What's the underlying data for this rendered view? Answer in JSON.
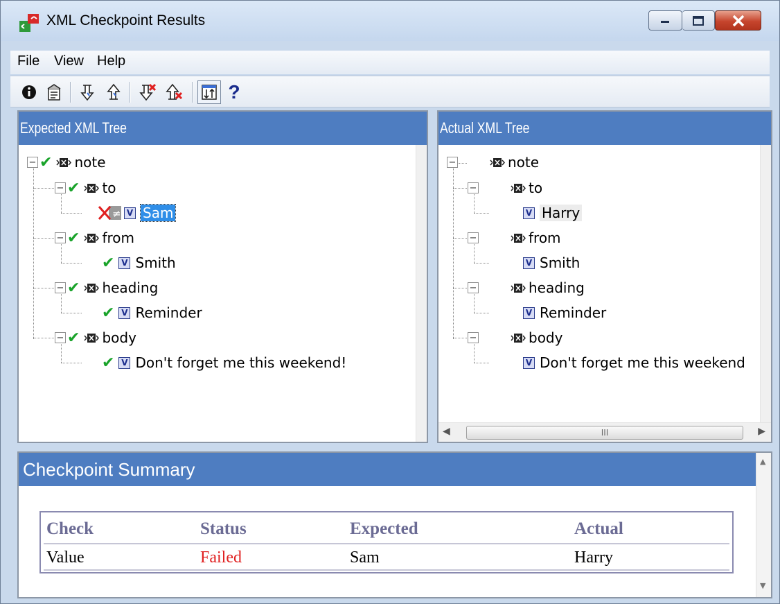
{
  "window": {
    "title": "XML Checkpoint Results"
  },
  "menu": {
    "items": [
      "File",
      "View",
      "Help"
    ]
  },
  "toolbar": {
    "buttons": [
      "info-icon",
      "properties-icon",
      "next-down-icon",
      "previous-up-icon",
      "next-error-icon",
      "previous-error-icon",
      "sync-scroll-icon",
      "help-icon"
    ],
    "help_glyph": "?"
  },
  "expected_tree": {
    "header": "Expected XML Tree",
    "nodes": [
      {
        "label": "note",
        "type": "element",
        "status": "pass"
      },
      {
        "label": "to",
        "type": "element",
        "status": "pass"
      },
      {
        "label": "Sam",
        "type": "value",
        "status": "fail",
        "selected": true
      },
      {
        "label": "from",
        "type": "element",
        "status": "pass"
      },
      {
        "label": "Smith",
        "type": "value",
        "status": "pass"
      },
      {
        "label": "heading",
        "type": "element",
        "status": "pass"
      },
      {
        "label": "Reminder",
        "type": "value",
        "status": "pass"
      },
      {
        "label": "body",
        "type": "element",
        "status": "pass"
      },
      {
        "label": "Don't forget me this weekend!",
        "type": "value",
        "status": "pass"
      }
    ]
  },
  "actual_tree": {
    "header": "Actual XML Tree",
    "nodes": [
      {
        "label": "note",
        "type": "element"
      },
      {
        "label": "to",
        "type": "element"
      },
      {
        "label": "Harry",
        "type": "value",
        "highlighted": true
      },
      {
        "label": "from",
        "type": "element"
      },
      {
        "label": "Smith",
        "type": "value"
      },
      {
        "label": "heading",
        "type": "element"
      },
      {
        "label": "Reminder",
        "type": "value"
      },
      {
        "label": "body",
        "type": "element"
      },
      {
        "label": "Don't forget me this weekend",
        "type": "value"
      }
    ],
    "scroll_thumb_glyph": "III"
  },
  "summary": {
    "header": "Checkpoint Summary",
    "columns": [
      "Check",
      "Status",
      "Expected",
      "Actual"
    ],
    "rows": [
      {
        "check": "Value",
        "status": "Failed",
        "expected": "Sam",
        "actual": "Harry"
      }
    ]
  },
  "colors": {
    "header_blue": "#4e7dc1",
    "pass_green": "#19a32a",
    "fail_red": "#e02020",
    "selection": "#2f8ee8"
  }
}
